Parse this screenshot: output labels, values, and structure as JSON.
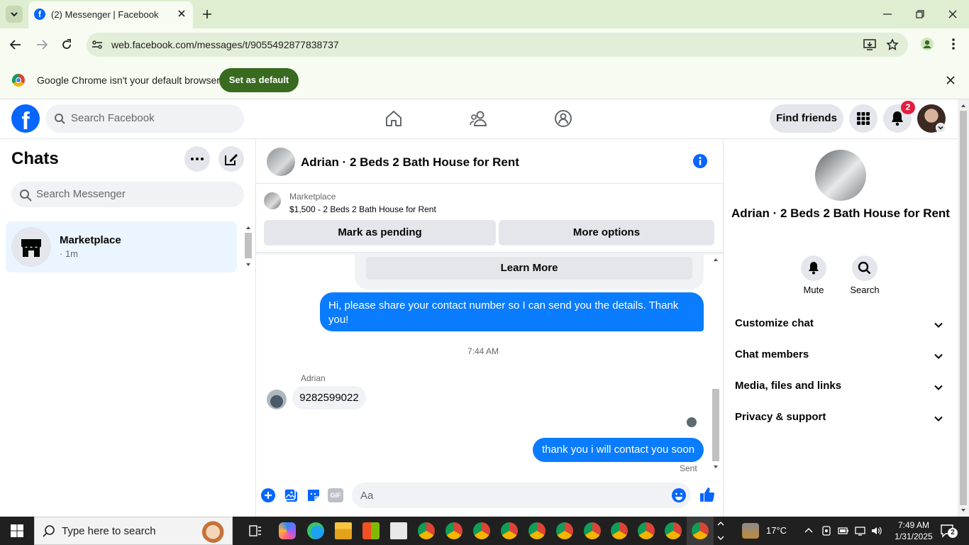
{
  "browser": {
    "tab_title": "(2) Messenger | Facebook",
    "url": "web.facebook.com/messages/t/9055492877838737",
    "infobar_text": "Google Chrome isn't your default browser",
    "set_default_label": "Set as default"
  },
  "fb_header": {
    "search_placeholder": "Search Facebook",
    "find_friends_label": "Find friends",
    "notification_count": "2"
  },
  "sidebar": {
    "title": "Chats",
    "search_placeholder": "Search Messenger",
    "chats": [
      {
        "name": "Marketplace",
        "meta": "· 1m"
      }
    ]
  },
  "conversation": {
    "title": "Adrian · 2 Beds 2 Bath House for Rent",
    "listing_source": "Marketplace",
    "listing_title": "$1,500 - 2 Beds 2 Bath House for Rent",
    "mark_pending_label": "Mark as pending",
    "more_options_label": "More options",
    "learn_more_label": "Learn More",
    "messages": [
      {
        "from": "me",
        "text": "Hi, please share your contact number so I can send you the details. Thank you!"
      },
      {
        "from": "Adrian",
        "text": "9282599022"
      },
      {
        "from": "me",
        "text": "thank you i will contact you soon"
      }
    ],
    "timestamp": "7:44 AM",
    "sender_name": "Adrian",
    "status": "Sent",
    "composer_placeholder": "Aa"
  },
  "info_panel": {
    "name": "Adrian · 2 Beds 2 Bath House for Rent",
    "actions": [
      {
        "label": "Mute",
        "icon": "bell-icon"
      },
      {
        "label": "Search",
        "icon": "search-icon"
      }
    ],
    "sections": [
      "Customize chat",
      "Chat members",
      "Media, files and links",
      "Privacy & support"
    ]
  },
  "taskbar": {
    "search_placeholder": "Type here to search",
    "weather": "17°C",
    "time": "7:49 AM",
    "date": "1/31/2025",
    "notification_count": "2"
  },
  "colors": {
    "messenger_blue": "#0a7cff",
    "facebook_blue": "#0866ff",
    "chrome_green": "#386a20"
  }
}
